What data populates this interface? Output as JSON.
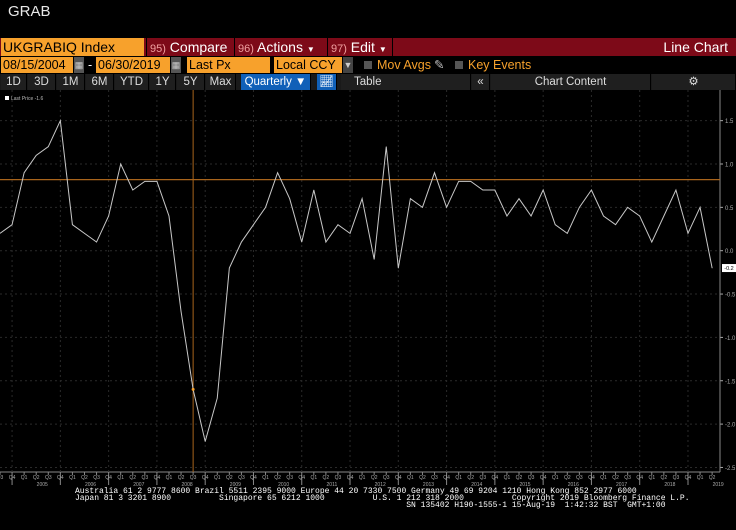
{
  "window_title": "GRAB",
  "toolbar": {
    "ticker": "UKGRABIQ Index",
    "compare_num": "95)",
    "compare": "Compare",
    "actions_num": "96)",
    "actions": "Actions",
    "edit_num": "97)",
    "edit": "Edit",
    "chart_type": "Line Chart"
  },
  "options": {
    "start_date": "08/15/2004",
    "end_date": "06/30/2019",
    "field": "Last Px",
    "currency": "Local CCY",
    "mov_avgs": "Mov Avgs",
    "key_events": "Key Events"
  },
  "periods": [
    "1D",
    "3D",
    "1M",
    "6M",
    "YTD",
    "1Y",
    "5Y",
    "Max"
  ],
  "frequency": "Quarterly ▼",
  "table_label": "Table",
  "collapse": "«",
  "chart_content": "Chart Content",
  "colors": {
    "accent": "#f7a12c",
    "bar": "#7d0a18",
    "selected": "#1060b8",
    "line": "#c8c8c8"
  },
  "footer": {
    "line1": "Australia 61 2 9777 8600 Brazil 5511 2395 9000 Europe 44 20 7330 7500 Germany 49 69 9204 1210 Hong Kong 852 2977 6000",
    "line2": "Japan 81 3 3201 8900          Singapore 65 6212 1000          U.S. 1 212 318 2000          Copyright 2019 Bloomberg Finance L.P.",
    "line3": "                                                                     SN 135402 H190-1555-1 15-Aug-19  1:42:32 BST  GMT+1:00"
  },
  "chart_data": {
    "type": "line",
    "legend": "Last Price -1.6",
    "last_value_label": "-0.2",
    "ylim": [
      -2.5,
      1.6
    ],
    "yticks": [
      "1.5",
      "1.0",
      "0.5",
      "0.0",
      "-0.5",
      "-1.0",
      "-1.5",
      "-2.0",
      "-2.5"
    ],
    "grid": true,
    "reference_line": 0.82,
    "cursor": {
      "quarter": "Q3 2008",
      "value": -1.6
    },
    "start": "Q3 2004",
    "years": [
      "2005",
      "2006",
      "2007",
      "2008",
      "2009",
      "2010",
      "2011",
      "2012",
      "2013",
      "2014",
      "2015",
      "2016",
      "2017",
      "2018",
      "2019"
    ],
    "series": [
      {
        "values": [
          0.2,
          0.3,
          0.9,
          1.1,
          1.2,
          1.5,
          0.3,
          0.2,
          0.1,
          0.4,
          1.0,
          0.7,
          0.8,
          0.8,
          0.4,
          -0.7,
          -1.6,
          -2.2,
          -1.7,
          -0.2,
          0.1,
          0.3,
          0.5,
          0.9,
          0.6,
          0.1,
          0.7,
          0.1,
          0.3,
          0.2,
          0.6,
          -0.1,
          1.2,
          -0.2,
          0.6,
          0.5,
          0.9,
          0.5,
          0.8,
          0.8,
          0.7,
          0.7,
          0.4,
          0.6,
          0.4,
          0.7,
          0.3,
          0.2,
          0.5,
          0.7,
          0.4,
          0.3,
          0.5,
          0.4,
          0.1,
          0.4,
          0.7,
          0.2,
          0.5,
          -0.2
        ]
      }
    ]
  }
}
